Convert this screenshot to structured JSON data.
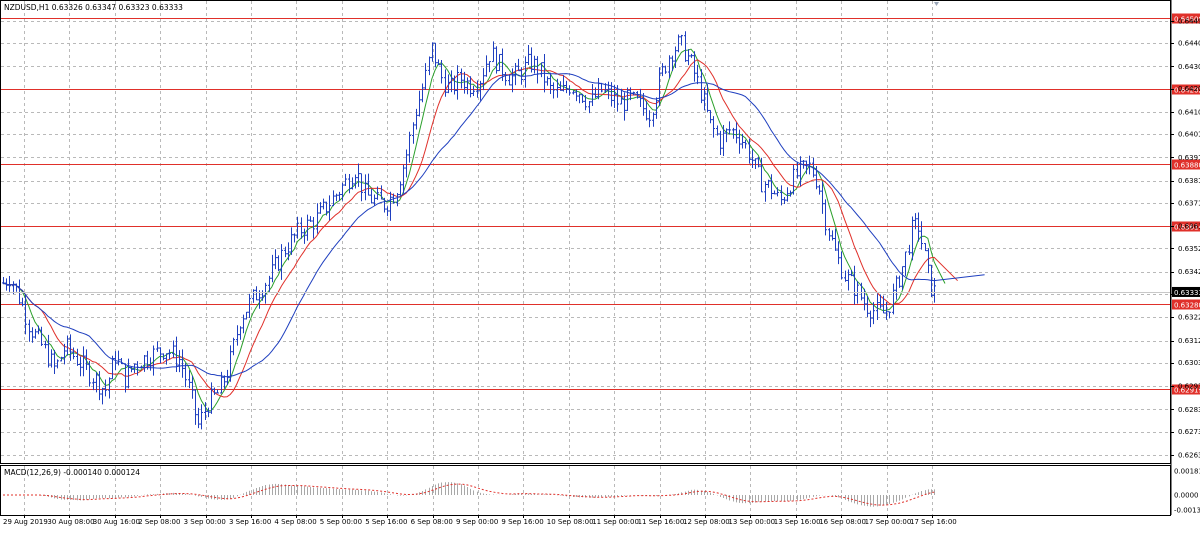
{
  "window": {
    "title": "NZDUSD,H1  0.63326 0.63347 0.63323 0.63333",
    "bg_color": "#ffffff",
    "grid_color": "#b9b9b9",
    "candle_color": "#1f3fbf",
    "level_line_color": "#e0302a",
    "current_price_tag_bg": "#000000"
  },
  "macd": {
    "title": "MACD(12,26,9) -0.000140 0.000124",
    "upper": "0.00181",
    "zero": "0.0000",
    "lower": "-0.00138",
    "histogram_color": "#a8a8a8",
    "signal_color": "#e0302a"
  },
  "price_axis": {
    "labels": [
      "0.64495",
      "0.64400",
      "0.64300",
      "0.64205",
      "0.64105",
      "0.64010",
      "0.63910",
      "0.63810",
      "0.63715",
      "0.63615",
      "0.63520",
      "0.63420",
      "0.63325",
      "0.63225",
      "0.63125",
      "0.63030",
      "0.62930",
      "0.62830",
      "0.62735",
      "0.62635"
    ],
    "current_price": "0.63333"
  },
  "level_lines": [
    {
      "label": "0.64509",
      "price": 0.64509
    },
    {
      "label": "0.64202",
      "price": 0.64202
    },
    {
      "label": "0.63880",
      "price": 0.6388
    },
    {
      "label": "0.63614",
      "price": 0.63614
    },
    {
      "label": "0.63280",
      "price": 0.6328
    },
    {
      "label": "0.62919",
      "price": 0.62919
    }
  ],
  "time_axis": {
    "labels": [
      "29 Aug 2019",
      "30 Aug 08:00",
      "30 Aug 16:00",
      "2 Sep 08:00",
      "3 Sep 00:00",
      "3 Sep 16:00",
      "4 Sep 08:00",
      "5 Sep 00:00",
      "5 Sep 16:00",
      "6 Sep 08:00",
      "9 Sep 00:00",
      "9 Sep 16:00",
      "10 Sep 08:00",
      "11 Sep 00:00",
      "11 Sep 16:00",
      "12 Sep 08:00",
      "13 Sep 00:00",
      "13 Sep 16:00",
      "16 Sep 08:00",
      "17 Sep 00:00",
      "17 Sep 16:00"
    ]
  },
  "chart_data": {
    "type": "candlestick",
    "symbol": "NZDUSD",
    "timeframe": "H1",
    "ylim": [
      0.626,
      0.6458
    ],
    "path_points": [
      [
        0,
        0.6336
      ],
      [
        10,
        0.634
      ],
      [
        20,
        0.633
      ],
      [
        30,
        0.6318
      ],
      [
        45,
        0.6308
      ],
      [
        55,
        0.63
      ],
      [
        65,
        0.631
      ],
      [
        80,
        0.6303
      ],
      [
        95,
        0.6296
      ],
      [
        105,
        0.6291
      ],
      [
        115,
        0.6306
      ],
      [
        125,
        0.6296
      ],
      [
        135,
        0.6303
      ],
      [
        150,
        0.6306
      ],
      [
        165,
        0.6309
      ],
      [
        180,
        0.6304
      ],
      [
        190,
        0.629
      ],
      [
        198,
        0.6276
      ],
      [
        208,
        0.6286
      ],
      [
        218,
        0.629
      ],
      [
        228,
        0.63
      ],
      [
        240,
        0.6322
      ],
      [
        255,
        0.6332
      ],
      [
        270,
        0.634
      ],
      [
        285,
        0.6352
      ],
      [
        300,
        0.636
      ],
      [
        315,
        0.6364
      ],
      [
        330,
        0.6372
      ],
      [
        345,
        0.638
      ],
      [
        355,
        0.6386
      ],
      [
        365,
        0.6375
      ],
      [
        375,
        0.6372
      ],
      [
        385,
        0.6371
      ],
      [
        395,
        0.6376
      ],
      [
        405,
        0.639
      ],
      [
        415,
        0.641
      ],
      [
        425,
        0.6425
      ],
      [
        432,
        0.6438
      ],
      [
        440,
        0.6426
      ],
      [
        450,
        0.642
      ],
      [
        460,
        0.6425
      ],
      [
        470,
        0.6422
      ],
      [
        480,
        0.6425
      ],
      [
        490,
        0.6436
      ],
      [
        500,
        0.643
      ],
      [
        510,
        0.6425
      ],
      [
        520,
        0.6427
      ],
      [
        530,
        0.6432
      ],
      [
        540,
        0.6428
      ],
      [
        550,
        0.642
      ],
      [
        560,
        0.6418
      ],
      [
        570,
        0.6422
      ],
      [
        580,
        0.6419
      ],
      [
        590,
        0.6414
      ],
      [
        600,
        0.642
      ],
      [
        610,
        0.6417
      ],
      [
        620,
        0.6414
      ],
      [
        630,
        0.6416
      ],
      [
        640,
        0.6413
      ],
      [
        650,
        0.641
      ],
      [
        660,
        0.6425
      ],
      [
        670,
        0.6436
      ],
      [
        680,
        0.644
      ],
      [
        690,
        0.6432
      ],
      [
        700,
        0.642
      ],
      [
        710,
        0.6405
      ],
      [
        720,
        0.6398
      ],
      [
        730,
        0.6403
      ],
      [
        740,
        0.64
      ],
      [
        750,
        0.6392
      ],
      [
        760,
        0.6381
      ],
      [
        770,
        0.6378
      ],
      [
        780,
        0.6372
      ],
      [
        790,
        0.638
      ],
      [
        800,
        0.6385
      ],
      [
        810,
        0.6387
      ],
      [
        818,
        0.638
      ],
      [
        825,
        0.6365
      ],
      [
        835,
        0.635
      ],
      [
        845,
        0.634
      ],
      [
        855,
        0.6335
      ],
      [
        865,
        0.6328
      ],
      [
        875,
        0.6325
      ],
      [
        885,
        0.6324
      ],
      [
        895,
        0.6334
      ],
      [
        905,
        0.6348
      ],
      [
        912,
        0.636
      ],
      [
        918,
        0.6362
      ],
      [
        925,
        0.6347
      ],
      [
        930,
        0.6336
      ],
      [
        935,
        0.6333
      ]
    ],
    "ma_series": [
      {
        "color": "#2ca02c",
        "lag": 6
      },
      {
        "color": "#e0302a",
        "lag": 13
      },
      {
        "color": "#1f3fbf",
        "lag": 28
      }
    ]
  }
}
